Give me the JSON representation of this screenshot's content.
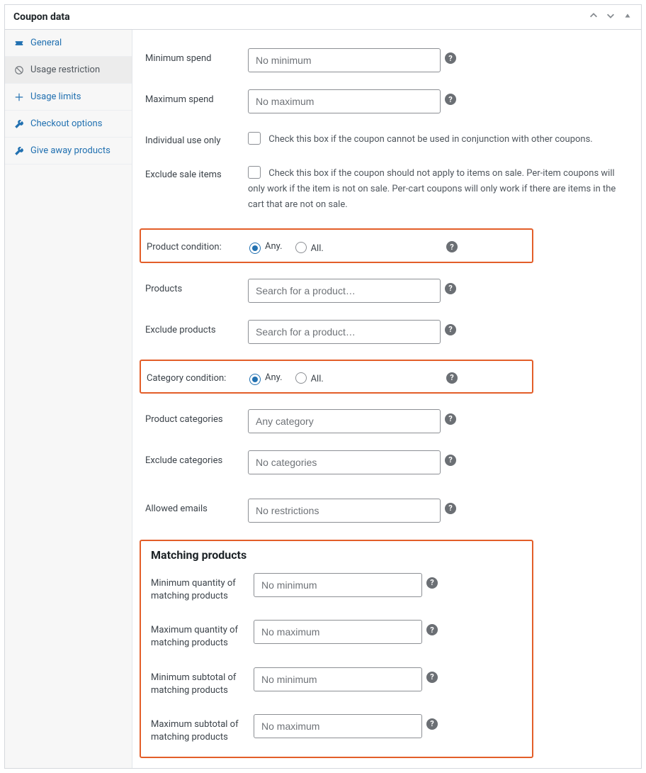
{
  "panel": {
    "title": "Coupon data"
  },
  "sidebar": {
    "items": [
      {
        "label": "General"
      },
      {
        "label": "Usage restriction"
      },
      {
        "label": "Usage limits"
      },
      {
        "label": "Checkout options"
      },
      {
        "label": "Give away products"
      }
    ]
  },
  "fields": {
    "min_spend": {
      "label": "Minimum spend",
      "placeholder": "No minimum"
    },
    "max_spend": {
      "label": "Maximum spend",
      "placeholder": "No maximum"
    },
    "individual": {
      "label": "Individual use only",
      "desc": "Check this box if the coupon cannot be used in conjunction with other coupons."
    },
    "exclude_sale": {
      "label": "Exclude sale items",
      "desc": "Check this box if the coupon should not apply to items on sale. Per-item coupons will only work if the item is not on sale. Per-cart coupons will only work if there are items in the cart that are not on sale."
    },
    "product_condition": {
      "label": "Product condition:",
      "any": "Any.",
      "all": "All."
    },
    "products": {
      "label": "Products",
      "placeholder": "Search for a product…"
    },
    "exclude_products": {
      "label": "Exclude products",
      "placeholder": "Search for a product…"
    },
    "category_condition": {
      "label": "Category condition:",
      "any": "Any.",
      "all": "All."
    },
    "product_categories": {
      "label": "Product categories",
      "placeholder": "Any category"
    },
    "exclude_categories": {
      "label": "Exclude categories",
      "placeholder": "No categories"
    },
    "allowed_emails": {
      "label": "Allowed emails",
      "placeholder": "No restrictions"
    }
  },
  "matching": {
    "title": "Matching products",
    "min_qty": {
      "label": "Minimum quantity of matching products",
      "placeholder": "No minimum"
    },
    "max_qty": {
      "label": "Maximum quantity of matching products",
      "placeholder": "No maximum"
    },
    "min_subtotal": {
      "label": "Minimum subtotal of matching products",
      "placeholder": "No minimum"
    },
    "max_subtotal": {
      "label": "Maximum subtotal of matching products",
      "placeholder": "No maximum"
    }
  }
}
